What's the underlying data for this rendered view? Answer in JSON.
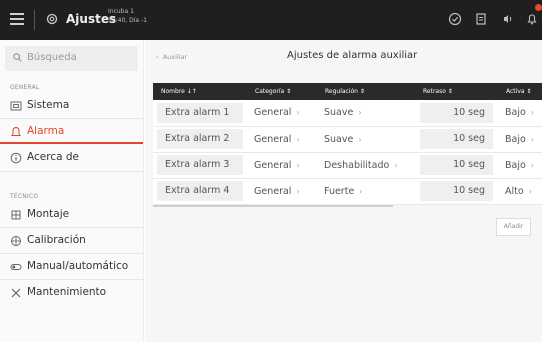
{
  "topbar": {
    "title": "Ajustes",
    "subtitle_line1": "Incuba 1",
    "subtitle_line2": "12:40, Día -1",
    "icons": [
      "menu-icon",
      "gear-icon",
      "check-circle-icon",
      "document-icon",
      "sound-icon",
      "bell-icon"
    ],
    "notification_color": "#e8462a"
  },
  "sidebar": {
    "search_placeholder": "Búsqueda",
    "section_general": "GENERAL",
    "section_tecnico": "TÉCNICO",
    "items": [
      {
        "label": "Sistema",
        "icon": "system-icon"
      },
      {
        "label": "Alarma",
        "icon": "alarm-icon",
        "active": true
      },
      {
        "label": "Acerca de",
        "icon": "info-icon"
      },
      {
        "label": "Montaje",
        "icon": "mounting-icon"
      },
      {
        "label": "Calibración",
        "icon": "calibration-icon"
      },
      {
        "label": "Manual/automático",
        "icon": "toggle-icon"
      },
      {
        "label": "Mantenimiento",
        "icon": "tools-icon"
      }
    ]
  },
  "main": {
    "back_label": "Auxiliar",
    "title": "Ajustes de alarma auxiliar",
    "columns": [
      "Nombre ↓↑",
      "Categoría ⇕",
      "Regulación ⇕",
      "Retraso ⇕",
      "Activa ⇕"
    ],
    "rows": [
      {
        "name": "Extra alarm 1",
        "category": "General",
        "regulation": "Suave",
        "delay": "10 seg",
        "active": "Bajo"
      },
      {
        "name": "Extra alarm 2",
        "category": "General",
        "regulation": "Suave",
        "delay": "10 seg",
        "active": "Bajo"
      },
      {
        "name": "Extra alarm 3",
        "category": "General",
        "regulation": "Deshabilitado",
        "delay": "10 seg",
        "active": "Bajo"
      },
      {
        "name": "Extra alarm 4",
        "category": "General",
        "regulation": "Fuerte",
        "delay": "10 seg",
        "active": "Alto"
      }
    ],
    "add_button": "Añadir",
    "accent_color": "#e8462a"
  }
}
